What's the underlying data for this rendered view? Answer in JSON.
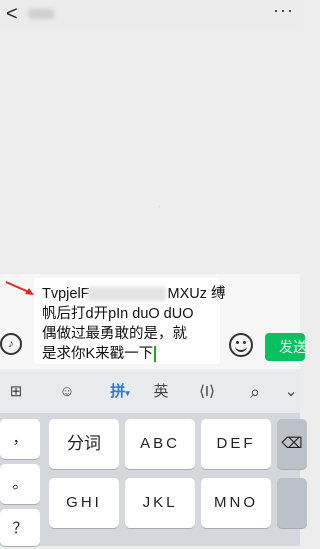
{
  "header": {
    "back_icon": "back-chevron-icon",
    "more_label": "···"
  },
  "composer": {
    "lines": [
      {
        "start": "TvpjelF",
        "end": "MXUz  缚"
      },
      {
        "text": "帆后打d开pIn duO dUO"
      },
      {
        "text": "偶做过最勇敢的是，就"
      },
      {
        "text": "是求你K来戳一下"
      }
    ],
    "send_label": "发送",
    "voice_label": "♪",
    "annotation": "red-arrow-icon"
  },
  "keyboard": {
    "toolbar": {
      "grid": "⊞",
      "emoji": "☺",
      "pinyin": "拼",
      "english": "英",
      "cursor": "⟨I⟩",
      "search": "⌕",
      "collapse": "⌄"
    },
    "left_column": [
      "，",
      "。",
      "？"
    ],
    "row1": [
      "分词",
      "ABC",
      "DEF"
    ],
    "row2": [
      "GHI",
      "JKL",
      "MNO"
    ],
    "backspace": "⌫"
  }
}
